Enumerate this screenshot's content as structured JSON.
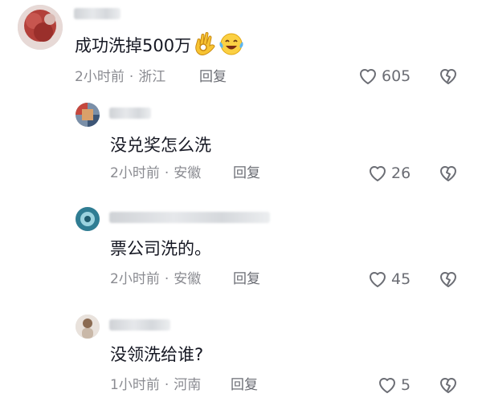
{
  "comments": [
    {
      "content": "成功洗掉500万",
      "emojis": [
        "ok-hand-emoji",
        "tears-of-joy-emoji"
      ],
      "time": "2小时前",
      "location": "浙江",
      "reply": "回复",
      "likes": "605"
    },
    {
      "content": "没兑奖怎么洗",
      "time": "2小时前",
      "location": "安徽",
      "reply": "回复",
      "likes": "26"
    },
    {
      "content": "票公司洗的。",
      "time": "2小时前",
      "location": "安徽",
      "reply": "回复",
      "likes": "45"
    },
    {
      "content": "没领洗给谁?",
      "time": "1小时前",
      "location": "河南",
      "reply": "回复",
      "likes": "5"
    }
  ],
  "separator": "·",
  "colors": {
    "text": "#161823",
    "meta": "#8a8b91",
    "icon": "#6b6d74"
  }
}
